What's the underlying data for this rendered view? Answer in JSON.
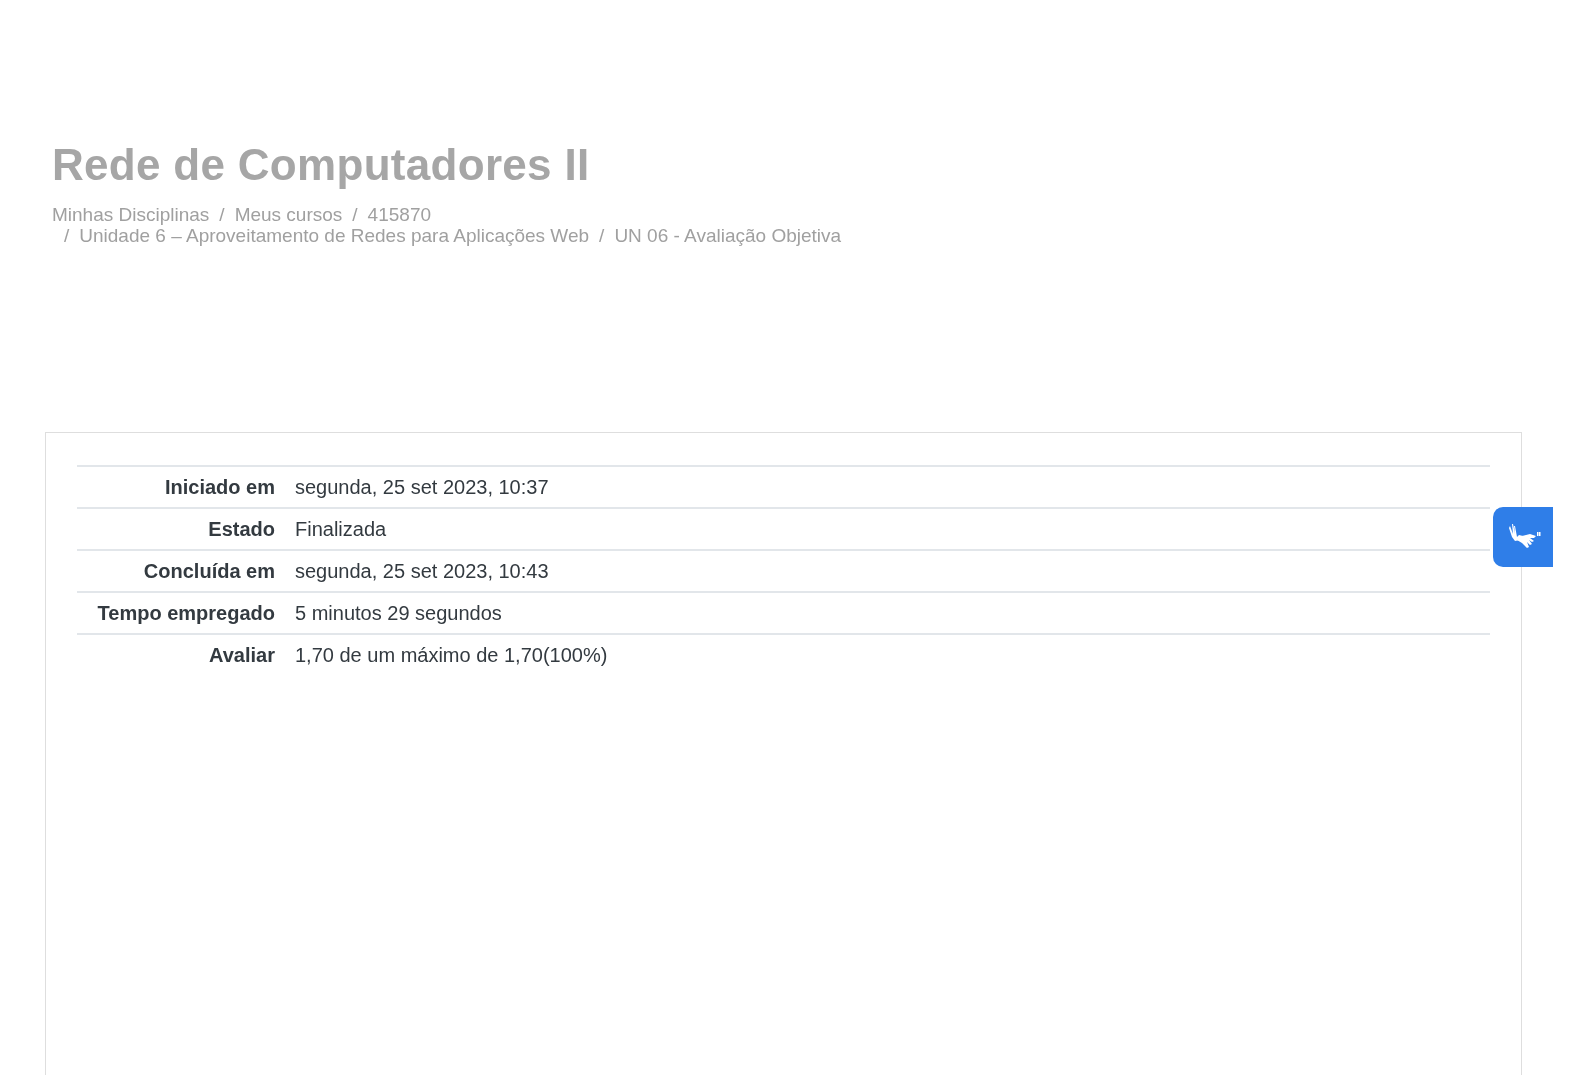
{
  "page_title": "Rede de Computadores II",
  "breadcrumb": {
    "separator": "/",
    "lines": [
      [
        {
          "label": "Minhas Disciplinas"
        },
        {
          "label": "Meus cursos"
        },
        {
          "label": "415870"
        }
      ],
      [
        {
          "label": "Unidade 6 – Aproveitamento de Redes para Aplicações Web"
        },
        {
          "label": "UN 06 - Avaliação Objetiva"
        }
      ]
    ]
  },
  "summary": [
    {
      "label": "Iniciado em",
      "value": "segunda, 25 set 2023, 10:37"
    },
    {
      "label": "Estado",
      "value": "Finalizada"
    },
    {
      "label": "Concluída em",
      "value": "segunda, 25 set 2023, 10:43"
    },
    {
      "label": "Tempo empregado",
      "value": "5 minutos 29 segundos"
    },
    {
      "label": "Avaliar",
      "value": "1,70 de um máximo de 1,70(100%)"
    }
  ]
}
